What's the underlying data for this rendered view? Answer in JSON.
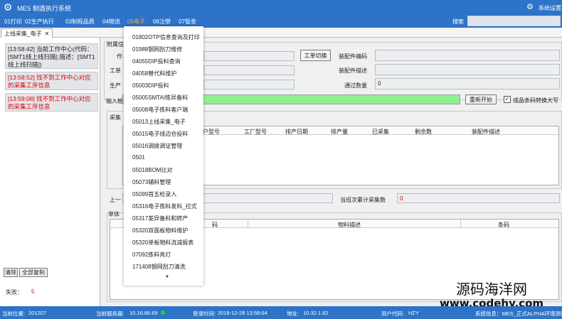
{
  "titlebar": {
    "logo_icon": "gear-logo-icon",
    "title": "MES 制造执行系统",
    "settings": "系统设置"
  },
  "menu": {
    "items": [
      "01打印",
      "02生产执行",
      "03制程品质",
      "04物流",
      "05电子",
      "06注塑",
      "07钣金"
    ],
    "active": "05电子",
    "search_label": "搜索",
    "search_value": ""
  },
  "tab": {
    "label": "上线采集_电子",
    "close": "✕"
  },
  "log": [
    {
      "text": "[13:58:42] 当前工作中心(代码：[SMT1线上线扫描],描述：[SMT1线上线扫描])",
      "color": "black"
    },
    {
      "text": "[13:58:52] 找不到工作中心对应的采集工序信息",
      "color": "red"
    },
    {
      "text": "[13:59:08] 找不到工作中心对应的采集工序信息",
      "color": "red"
    }
  ],
  "left_buttons": {
    "clear": "清除",
    "copy_all": "全部复制"
  },
  "fail": {
    "label": "失败：",
    "value": "5"
  },
  "form": {
    "section_prefix": "附属信",
    "work_label": "作",
    "workorder_label": "工单",
    "production_label": "生产",
    "input_label": "输入框",
    "switch_button": "工单切换",
    "assembly_code_label": "装配件编码",
    "assembly_desc_label": "装配件描述",
    "pass_qty_label": "通过数量",
    "pass_qty_value": "0",
    "restart_button": "重新开始",
    "checkbox_label": "成品条码转换大写",
    "checkbox_checked": true
  },
  "collect_grid": {
    "label": "采集",
    "columns": [
      "户型号",
      "工厂型号",
      "排产日期",
      "排产量",
      "已采集",
      "剩余数",
      "装配件描述"
    ]
  },
  "prev_label": "上一",
  "shift_total": {
    "label": "当班次累计采集数",
    "value": "0"
  },
  "single_grid": {
    "label": "单体",
    "columns": [
      "码",
      "物料描述",
      "条码"
    ]
  },
  "dropdown": {
    "items": [
      "01802OTP信息查询及打印",
      "01988钢网刮刀维修",
      "04055DIP投料查询",
      "04058替代料维护",
      "05003DIP投料",
      "05005SMTAI拣异备料",
      "05008电子拣料客户端",
      "05013上线采集_电子",
      "05015电子线边仓投料",
      "05016调拨调证管理",
      "0501",
      "05018BOM比对",
      "05073辅料管理",
      "05099首五检录入",
      "05316电子拣料发料_拉式",
      "05317差异备料和转产",
      "05320双面板物料维护",
      "05320单板物料流减报表",
      "07092拣料亮灯",
      "171408钢网刮刀清洗"
    ],
    "more_icon": "▼"
  },
  "statusbar": {
    "location_label": "当前位置:",
    "location_value": "201207",
    "server_label": "当前服务器:",
    "server_value": "10.16.86.69",
    "login_label": "登录时间:",
    "login_value": "2018-12-28 13:58:04",
    "address_label": "地址:",
    "address_value": "10.32.1.82",
    "user_label": "用户代码:",
    "user_value": "HZY",
    "system_info": "系统信息：MES_正式ALPHA环境测试"
  },
  "watermark": {
    "line1": "源码海洋网",
    "line2": "www.codehy.com"
  }
}
